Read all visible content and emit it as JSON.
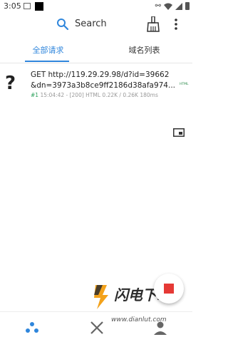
{
  "status_bar": {
    "time": "3:05"
  },
  "toolbar": {
    "search_label": "Search"
  },
  "tabs": [
    {
      "label": "全部请求"
    },
    {
      "label": "域名列表"
    }
  ],
  "requests": [
    {
      "url_line1": "GET http://119.29.29.98/d?id=39662",
      "url_line2": "&dn=3973a3b8ce9ff2186d38afa974...",
      "index": "#1",
      "meta": " 15:04:42 - [200] HTML 0.22K / 0.26K  180ms",
      "badge": "HTML"
    }
  ],
  "watermark": {
    "title": "闪电下载",
    "url": "www.dianlut.com"
  },
  "colors": {
    "accent": "#2f86dc",
    "stop": "#e53935",
    "success": "#2aa05a"
  }
}
